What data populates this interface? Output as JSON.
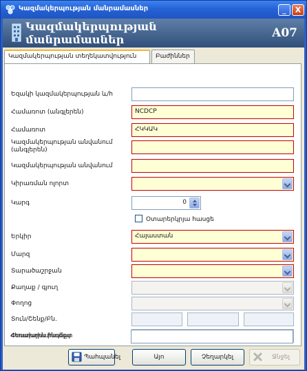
{
  "window": {
    "title": "Կազմակերպության մանրամասներ",
    "controls": {
      "minimize": "_",
      "close": "X"
    }
  },
  "header": {
    "title": "Կազմակերպության մանրամասներ",
    "code": "A07"
  },
  "tabs": [
    {
      "label": "Կազմակերպության տեղեկատվություն",
      "active": true
    },
    {
      "label": "Բաժիններ",
      "active": false
    }
  ],
  "form": {
    "register_number": {
      "label": "Եզակի կազմակերպության և/հ",
      "value": ""
    },
    "short_name_en": {
      "label": "Համառոտ (անգլերեն)",
      "value": "NCDCP"
    },
    "short_name": {
      "label": "Համառոտ",
      "value": "ՀԿԿԱԿ"
    },
    "full_name_en": {
      "label": "Կազմակերպության անվանում (անգլերեն)",
      "value": ""
    },
    "full_name": {
      "label": "Կազմակերպության անվանում",
      "value": ""
    },
    "field_of_activity": {
      "label": "Կիրառման ոլորտ",
      "value": ""
    },
    "level": {
      "label": "Կարգ",
      "value": "0"
    },
    "foreign": {
      "label": "Օտարերկրյա հասցե",
      "checked": false
    },
    "country": {
      "label": "Երկիր",
      "value": "Հայաստան"
    },
    "region": {
      "label": "Մարզ",
      "value": ""
    },
    "community": {
      "label": "Տարածաշրջան",
      "value": ""
    },
    "city": {
      "label": "Քաղաք / գյուղ",
      "value": ""
    },
    "street": {
      "label": "Փողոց",
      "value": ""
    },
    "building": {
      "label": "Տուն/Շենք/Բն.",
      "values": [
        "",
        "",
        ""
      ]
    },
    "postal_code": {
      "label": "Փոստային ինդեքս",
      "value": ""
    },
    "phone": {
      "label": "Հեռախոսահամար",
      "value": ""
    }
  },
  "buttons": {
    "save": "Պահպանել",
    "ok": "Այո",
    "cancel": "Չեղարկել",
    "delete": "Ջնջել"
  },
  "colors": {
    "title_bar": "#2563d6",
    "header_bg": "#30507b",
    "required_bg": "#ffffd6",
    "required_border": "#c00000",
    "tab_active_accent": "#f5b42c"
  }
}
